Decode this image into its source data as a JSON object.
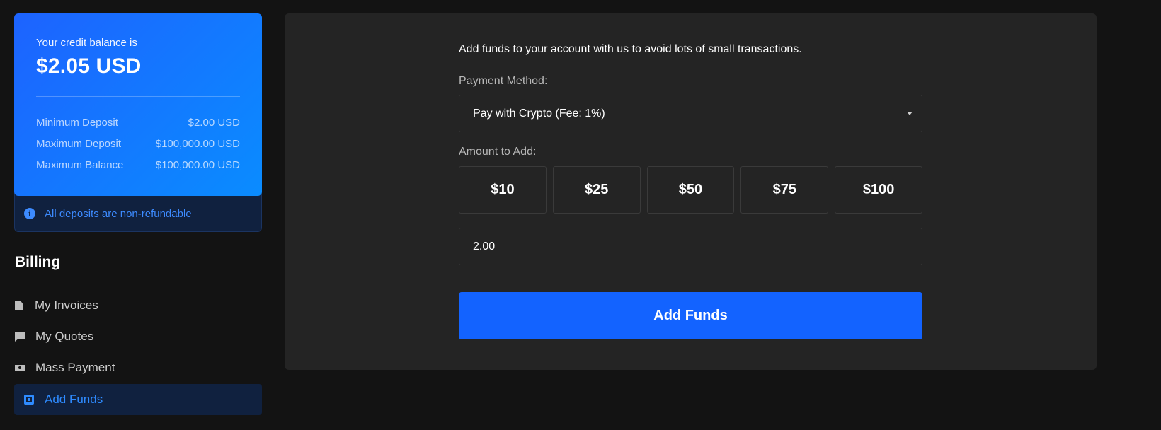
{
  "credit": {
    "label": "Your credit balance is",
    "amount": "$2.05 USD",
    "limits": [
      {
        "label": "Minimum Deposit",
        "value": "$2.00 USD"
      },
      {
        "label": "Maximum Deposit",
        "value": "$100,000.00 USD"
      },
      {
        "label": "Maximum Balance",
        "value": "$100,000.00 USD"
      }
    ],
    "notice": "All deposits are non-refundable"
  },
  "billing": {
    "title": "Billing",
    "items": [
      {
        "label": "My Invoices",
        "icon": "document-icon"
      },
      {
        "label": "My Quotes",
        "icon": "chat-icon"
      },
      {
        "label": "Mass Payment",
        "icon": "cash-icon"
      },
      {
        "label": "Add Funds",
        "icon": "add-funds-icon",
        "active": true
      }
    ]
  },
  "form": {
    "intro": "Add funds to your account with us to avoid lots of small transactions.",
    "payment_method_label": "Payment Method:",
    "payment_method_value": "Pay with Crypto (Fee: 1%)",
    "amount_label": "Amount to Add:",
    "presets": [
      "$10",
      "$25",
      "$50",
      "$75",
      "$100"
    ],
    "amount_value": "2.00",
    "submit_label": "Add Funds"
  },
  "colors": {
    "accent": "#1363ff",
    "active_nav_text": "#2e8bff",
    "notice_text": "#3d8bff"
  }
}
